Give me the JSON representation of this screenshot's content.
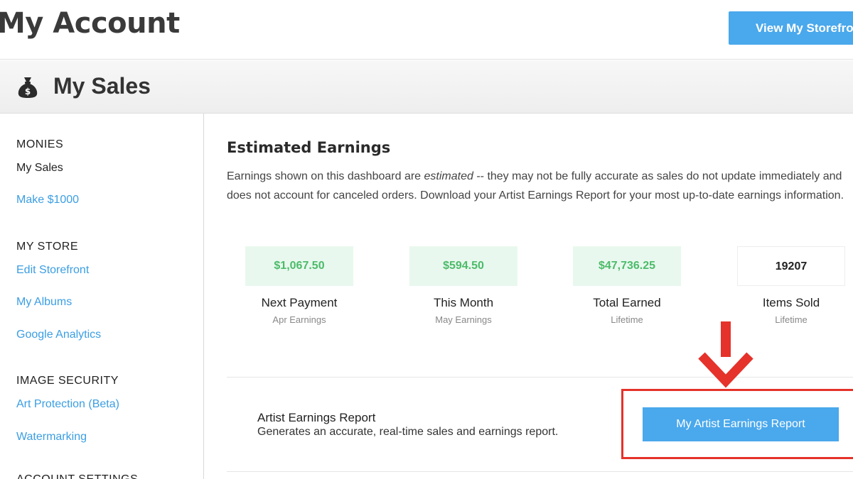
{
  "header": {
    "title": "My Account",
    "storefront_button": "View My Storefront"
  },
  "section": {
    "icon": "moneybag-icon",
    "title": "My Sales"
  },
  "sidebar": {
    "groups": [
      {
        "heading": "MONIES",
        "current": "My Sales",
        "links": [
          "Make $1000"
        ]
      },
      {
        "heading": "MY STORE",
        "links": [
          "Edit Storefront",
          "My Albums",
          "Google Analytics"
        ]
      },
      {
        "heading": "IMAGE SECURITY",
        "links": [
          "Art Protection (Beta)",
          "Watermarking"
        ]
      },
      {
        "heading": "ACCOUNT SETTINGS"
      }
    ]
  },
  "earnings": {
    "title": "Estimated Earnings",
    "desc_before": "Earnings shown on this dashboard are ",
    "desc_em": "estimated",
    "desc_after": " -- they may not be fully accurate as sales do not update immediately and does not account for canceled orders. Download your Artist Earnings Report for your most up-to-date earnings information.",
    "stats": [
      {
        "value": "$1,067.50",
        "label": "Next Payment",
        "sub": "Apr Earnings"
      },
      {
        "value": "$594.50",
        "label": "This Month",
        "sub": "May Earnings"
      },
      {
        "value": "$47,736.25",
        "label": "Total Earned",
        "sub": "Lifetime"
      },
      {
        "value": "19207",
        "label": "Items Sold",
        "sub": "Lifetime"
      }
    ]
  },
  "report": {
    "title": "Artist Earnings Report",
    "desc": "Generates an accurate, real-time sales and earnings report.",
    "button": "My Artist Earnings Report"
  },
  "colors": {
    "accent_blue": "#4aa8ec",
    "earnings_green": "#4cbb6a",
    "highlight_red": "#e5322a"
  }
}
